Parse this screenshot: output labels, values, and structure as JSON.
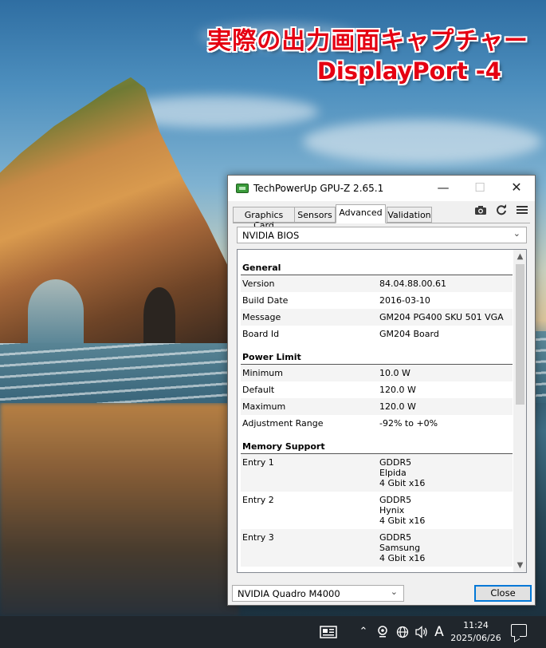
{
  "banner": {
    "line1": "実際の出力画面キャプチャー",
    "line2": "DisplayPort -4",
    "color": "#e50012"
  },
  "window": {
    "title": "TechPowerUp GPU-Z 2.65.1",
    "controls": {
      "minimize": "—",
      "maximize": "☐",
      "close": "✕"
    }
  },
  "tabs": [
    {
      "label": "Graphics Card"
    },
    {
      "label": "Sensors"
    },
    {
      "label": "Advanced",
      "active": true
    },
    {
      "label": "Validation"
    }
  ],
  "toolbar": {
    "icons": [
      "camera-icon",
      "refresh-icon",
      "menu-icon"
    ]
  },
  "category_select": {
    "value": "NVIDIA BIOS"
  },
  "sections": [
    {
      "title": "General",
      "rows": [
        {
          "key": "Version",
          "value": "84.04.88.00.61"
        },
        {
          "key": "Build Date",
          "value": "2016-03-10"
        },
        {
          "key": "Message",
          "value": "GM204 PG400 SKU 501 VGA"
        },
        {
          "key": "Board Id",
          "value": "GM204 Board"
        }
      ]
    },
    {
      "title": "Power Limit",
      "rows": [
        {
          "key": "Minimum",
          "value": "10.0 W"
        },
        {
          "key": "Default",
          "value": "120.0 W"
        },
        {
          "key": "Maximum",
          "value": "120.0 W"
        },
        {
          "key": "Adjustment Range",
          "value": "-92% to +0%"
        }
      ]
    },
    {
      "title": "Memory Support",
      "entries": [
        {
          "key": "Entry 1",
          "lines": [
            "GDDR5",
            "Elpida",
            "4 Gbit x16"
          ]
        },
        {
          "key": "Entry 2",
          "lines": [
            "GDDR5",
            "Hynix",
            "4 Gbit x16"
          ]
        },
        {
          "key": "Entry 3",
          "lines": [
            "GDDR5",
            "Samsung",
            "4 Gbit x16"
          ]
        }
      ]
    }
  ],
  "gpu_select": {
    "value": "NVIDIA Quadro M4000"
  },
  "close_button": {
    "label": "Close"
  },
  "taskbar": {
    "ime": "A",
    "time": "11:24",
    "date": "2025/06/26"
  }
}
